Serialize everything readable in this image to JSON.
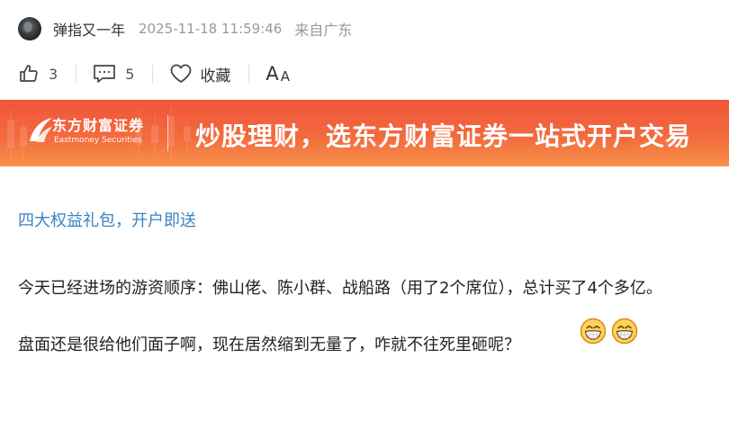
{
  "post": {
    "username": "弹指又一年",
    "timestamp": "2025-11-18 11:59:46",
    "location": "来自广东",
    "avatar_icon": "user-avatar"
  },
  "actions": {
    "like_icon": "thumbs-up-icon",
    "like_count": "3",
    "comment_icon": "comment-icon",
    "comment_count": "5",
    "favorite_icon": "heart-icon",
    "favorite_label": "收藏",
    "font_size_big": "A",
    "font_size_small": "A"
  },
  "banner": {
    "brand_cn": "东方财富证券",
    "brand_en": "Eastmoney Securities",
    "slogan": "炒股理财，选东方财富证券一站式开户交易",
    "colors": {
      "start": "#f0553a",
      "end": "#f7914a"
    }
  },
  "content": {
    "promo_link": "四大权益礼包，开户即送",
    "paragraph_1": "今天已经进场的游资顺序：佛山佬、陈小群、战船路（用了2个席位），总计买了4个多亿。",
    "paragraph_2": "盘面还是很给他们面子啊，现在居然缩到无量了，咋就不往死里砸呢？",
    "emoji": [
      "grinning-face-emoji",
      "grinning-face-emoji"
    ]
  },
  "colors": {
    "link": "#3a82c4",
    "meta": "#999999",
    "text": "#222222"
  }
}
